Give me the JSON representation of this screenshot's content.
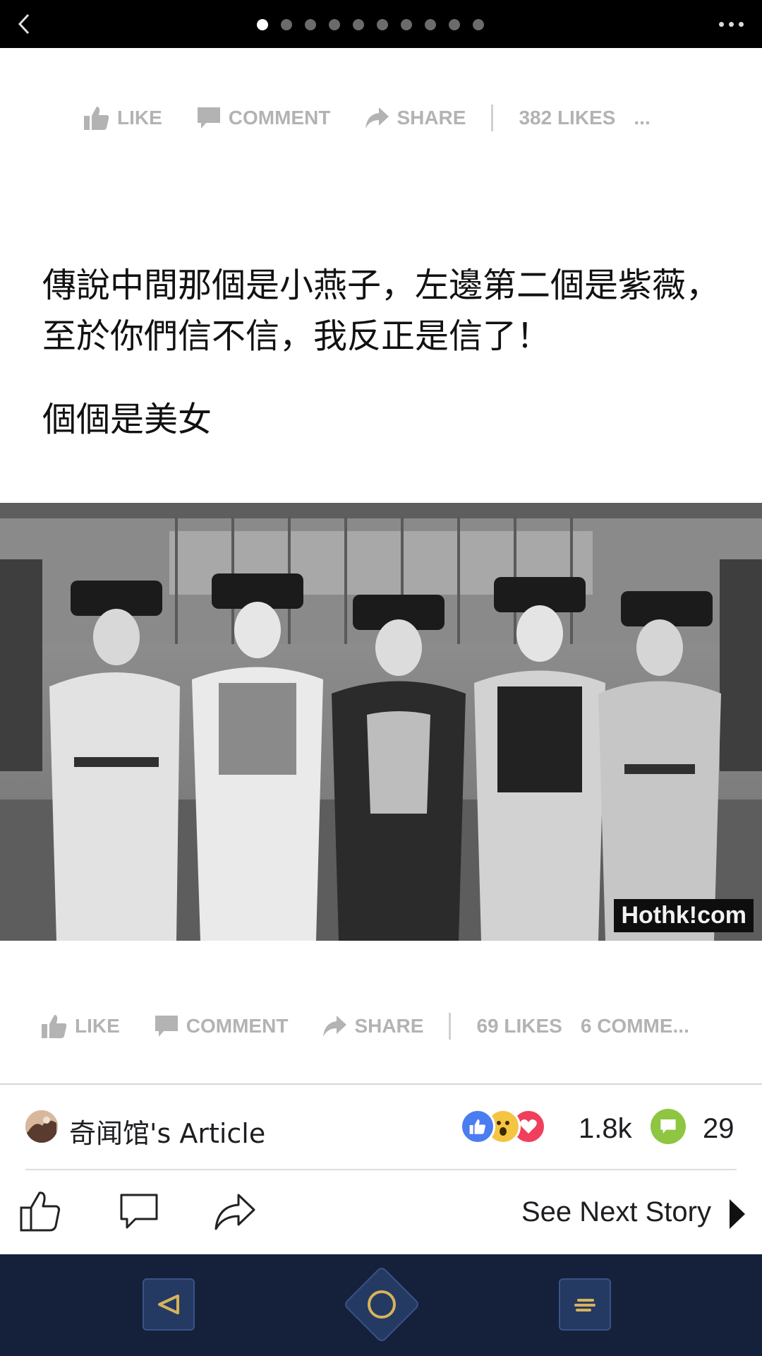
{
  "topbar": {
    "page_count": 10,
    "active_page": 1
  },
  "action_row_top": {
    "like": "LIKE",
    "comment": "COMMENT",
    "share": "SHARE",
    "likes": "382 LIKES",
    "more": "..."
  },
  "post": {
    "text": "傳說中間那個是小燕子，左邊第二個是紫薇，至於你們信不信，我反正是信了！",
    "text2": "個個是美女",
    "photo_watermark": "Hothk!com"
  },
  "action_row_bottom": {
    "like": "LIKE",
    "comment": "COMMENT",
    "share": "SHARE",
    "likes": "69 LIKES",
    "comments": "6 COMME..."
  },
  "article": {
    "title": "奇闻馆's Article",
    "reaction_count": "1.8k",
    "comment_count": "29"
  },
  "footer": {
    "next_story": "See Next Story"
  },
  "colors": {
    "like_blue": "#4a7df0",
    "wow_yellow": "#f5c542",
    "love_red": "#f03f5c",
    "comment_green": "#8ec641",
    "navbar": "#15203b",
    "nav_accent": "#d7b25a"
  }
}
